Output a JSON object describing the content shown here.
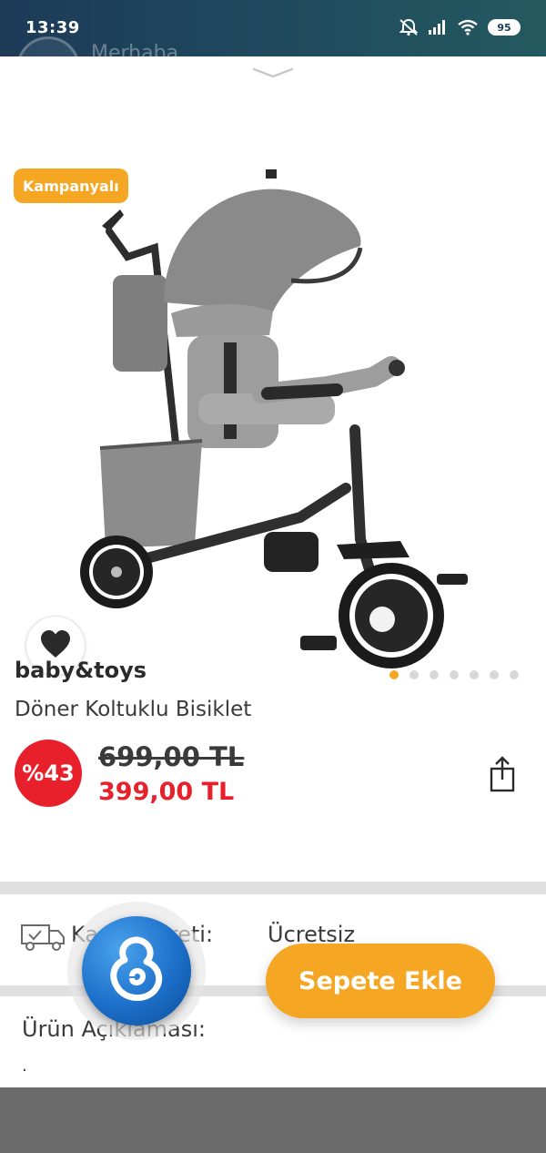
{
  "status_bar": {
    "time": "13:39",
    "battery": "95"
  },
  "background_app": {
    "greeting": "Merhaba"
  },
  "product": {
    "badge": "Kampanyalı",
    "brand": "baby&toys",
    "name": "Döner Koltuklu Bisiklet",
    "discount": "%43",
    "old_price": "699,00 TL",
    "new_price": "399,00 TL",
    "image_count": 7,
    "active_image_index": 0
  },
  "shipping": {
    "label": "Kargo Ücreti:",
    "value": "Ücretsiz"
  },
  "description": {
    "label": "Ürün Açıklaması:",
    "text": "."
  },
  "actions": {
    "add_to_cart": "Sepete Ekle"
  },
  "icons": {
    "favorite": "heart-icon",
    "share": "share-icon",
    "shipping": "truck-icon",
    "assistant": "app-logo-icon",
    "handle": "chevron-down-icon"
  },
  "colors": {
    "accent": "#f5a623",
    "sale": "#e8202c",
    "status_bar": "#1d3a57"
  }
}
